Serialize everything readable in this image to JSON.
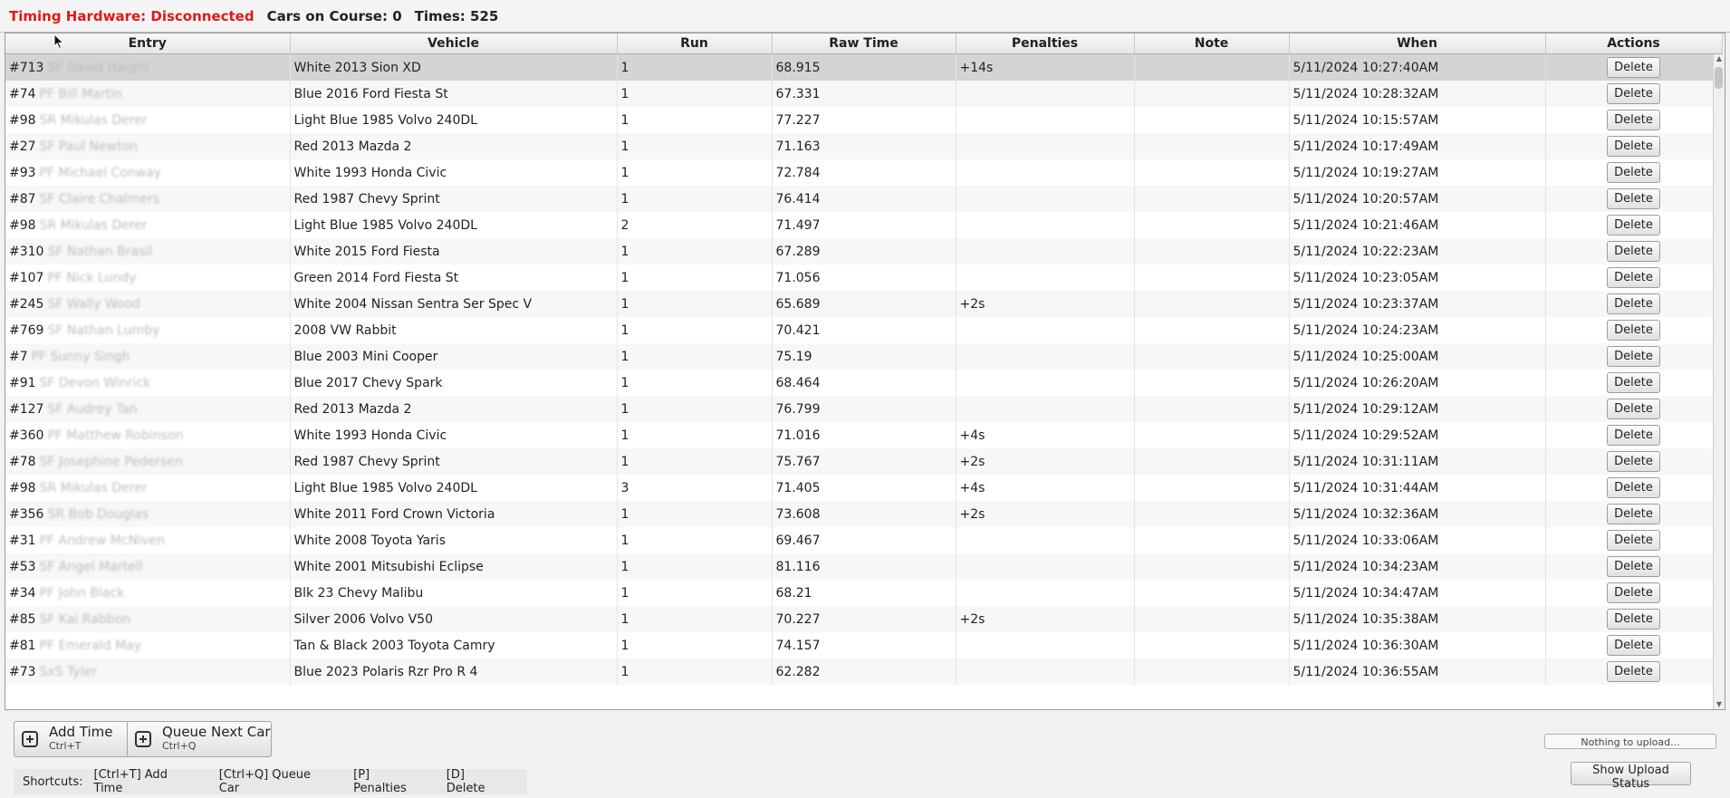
{
  "status": {
    "hardware": "Timing Hardware: Disconnected",
    "cars_on_course": "Cars on Course: 0",
    "times": "Times: 525"
  },
  "columns": [
    "Entry",
    "Vehicle",
    "Run",
    "Raw Time",
    "Penalties",
    "Note",
    "When",
    "Actions"
  ],
  "rows": [
    {
      "entry": "#713",
      "name": "SF David Haight",
      "vehicle": "White 2013 Sion XD",
      "run": "1",
      "raw": "68.915",
      "pen": "+14s",
      "note": "",
      "when": "5/11/2024 10:27:40AM"
    },
    {
      "entry": "#74",
      "name": "PF Bill Martin",
      "vehicle": "Blue 2016 Ford Fiesta St",
      "run": "1",
      "raw": "67.331",
      "pen": "",
      "note": "",
      "when": "5/11/2024 10:28:32AM"
    },
    {
      "entry": "#98",
      "name": "SR Mikulas Derer",
      "vehicle": "Light Blue  1985 Volvo  240DL",
      "run": "1",
      "raw": "77.227",
      "pen": "",
      "note": "",
      "when": "5/11/2024 10:15:57AM"
    },
    {
      "entry": "#27",
      "name": "SF Paul Newton",
      "vehicle": "Red 2013 Mazda 2",
      "run": "1",
      "raw": "71.163",
      "pen": "",
      "note": "",
      "when": "5/11/2024 10:17:49AM"
    },
    {
      "entry": "#93",
      "name": "PF Michael Conway",
      "vehicle": "White 1993 Honda Civic",
      "run": "1",
      "raw": "72.784",
      "pen": "",
      "note": "",
      "when": "5/11/2024 10:19:27AM"
    },
    {
      "entry": "#87",
      "name": "SF Claire Chalmers",
      "vehicle": "Red 1987 Chevy Sprint",
      "run": "1",
      "raw": "76.414",
      "pen": "",
      "note": "",
      "when": "5/11/2024 10:20:57AM"
    },
    {
      "entry": "#98",
      "name": "SR Mikulas Derer",
      "vehicle": "Light Blue  1985 Volvo  240DL",
      "run": "2",
      "raw": "71.497",
      "pen": "",
      "note": "",
      "when": "5/11/2024 10:21:46AM"
    },
    {
      "entry": "#310",
      "name": "SF Nathan Brasil",
      "vehicle": "White 2015 Ford Fiesta",
      "run": "1",
      "raw": "67.289",
      "pen": "",
      "note": "",
      "when": "5/11/2024 10:22:23AM"
    },
    {
      "entry": "#107",
      "name": "PF Nick Lundy",
      "vehicle": "Green 2014 Ford Fiesta St",
      "run": "1",
      "raw": "71.056",
      "pen": "",
      "note": "",
      "when": "5/11/2024 10:23:05AM"
    },
    {
      "entry": "#245",
      "name": "SF Wally Wood",
      "vehicle": "White 2004 Nissan  Sentra Ser Spec V",
      "run": "1",
      "raw": "65.689",
      "pen": "+2s",
      "note": "",
      "when": "5/11/2024 10:23:37AM"
    },
    {
      "entry": "#769",
      "name": "SF Nathan Lumby",
      "vehicle": "2008 VW Rabbit",
      "run": "1",
      "raw": "70.421",
      "pen": "",
      "note": "",
      "when": "5/11/2024 10:24:23AM"
    },
    {
      "entry": "#7",
      "name": "PF Sunny Singh",
      "vehicle": "Blue 2003 Mini Cooper",
      "run": "1",
      "raw": "75.19",
      "pen": "",
      "note": "",
      "when": "5/11/2024 10:25:00AM"
    },
    {
      "entry": "#91",
      "name": "SF Devon Winrick",
      "vehicle": "Blue 2017 Chevy Spark",
      "run": "1",
      "raw": "68.464",
      "pen": "",
      "note": "",
      "when": "5/11/2024 10:26:20AM"
    },
    {
      "entry": "#127",
      "name": "SF Audrey Tan",
      "vehicle": "Red 2013 Mazda 2",
      "run": "1",
      "raw": "76.799",
      "pen": "",
      "note": "",
      "when": "5/11/2024 10:29:12AM"
    },
    {
      "entry": "#360",
      "name": "PF Matthew Robinson",
      "vehicle": "White 1993 Honda Civic",
      "run": "1",
      "raw": "71.016",
      "pen": "+4s",
      "note": "",
      "when": "5/11/2024 10:29:52AM"
    },
    {
      "entry": "#78",
      "name": "SF Josephine Pedersen",
      "vehicle": "Red 1987 Chevy Sprint",
      "run": "1",
      "raw": "75.767",
      "pen": "+2s",
      "note": "",
      "when": "5/11/2024 10:31:11AM"
    },
    {
      "entry": "#98",
      "name": "SR Mikulas Derer",
      "vehicle": "Light Blue  1985 Volvo  240DL",
      "run": "3",
      "raw": "71.405",
      "pen": "+4s",
      "note": "",
      "when": "5/11/2024 10:31:44AM"
    },
    {
      "entry": "#356",
      "name": "SR Bob Douglas",
      "vehicle": "White 2011 Ford Crown Victoria",
      "run": "1",
      "raw": "73.608",
      "pen": "+2s",
      "note": "",
      "when": "5/11/2024 10:32:36AM"
    },
    {
      "entry": "#31",
      "name": "PF Andrew McNiven",
      "vehicle": "White 2008 Toyota  Yaris",
      "run": "1",
      "raw": "69.467",
      "pen": "",
      "note": "",
      "when": "5/11/2024 10:33:06AM"
    },
    {
      "entry": "#53",
      "name": "SF Angel Martell",
      "vehicle": "White 2001 Mitsubishi  Eclipse",
      "run": "1",
      "raw": "81.116",
      "pen": "",
      "note": "",
      "when": "5/11/2024 10:34:23AM"
    },
    {
      "entry": "#34",
      "name": "PF John Black",
      "vehicle": "Blk 23 Chevy Malibu",
      "run": "1",
      "raw": "68.21",
      "pen": "",
      "note": "",
      "when": "5/11/2024 10:34:47AM"
    },
    {
      "entry": "#85",
      "name": "SF Kai Rabbon",
      "vehicle": "Silver 2006 Volvo V50",
      "run": "1",
      "raw": "70.227",
      "pen": "+2s",
      "note": "",
      "when": "5/11/2024 10:35:38AM"
    },
    {
      "entry": "#81",
      "name": "PF Emerald May",
      "vehicle": "Tan & Black 2003 Toyota Camry",
      "run": "1",
      "raw": "74.157",
      "pen": "",
      "note": "",
      "when": "5/11/2024 10:36:30AM"
    },
    {
      "entry": "#73",
      "name": "SxS Tyler",
      "vehicle": "Blue 2023 Polaris Rzr Pro R 4",
      "run": "1",
      "raw": "62.282",
      "pen": "",
      "note": "",
      "when": "5/11/2024 10:36:55AM"
    }
  ],
  "row_action_label": "Delete",
  "buttons": {
    "add_time": "Add Time",
    "add_time_shortcut": "Ctrl+T",
    "queue_next": "Queue Next Car",
    "queue_next_shortcut": "Ctrl+Q",
    "upload_status": "Show Upload Status"
  },
  "upload_progress": "Nothing to upload...",
  "shortcuts": {
    "title": "Shortcuts:",
    "items": [
      "[Ctrl+T] Add Time",
      "[Ctrl+Q] Queue Car",
      "[P] Penalties",
      "[D] Delete"
    ]
  },
  "colors": {
    "disconnected": "#e01818",
    "selected_row": "#d4d4d4"
  }
}
